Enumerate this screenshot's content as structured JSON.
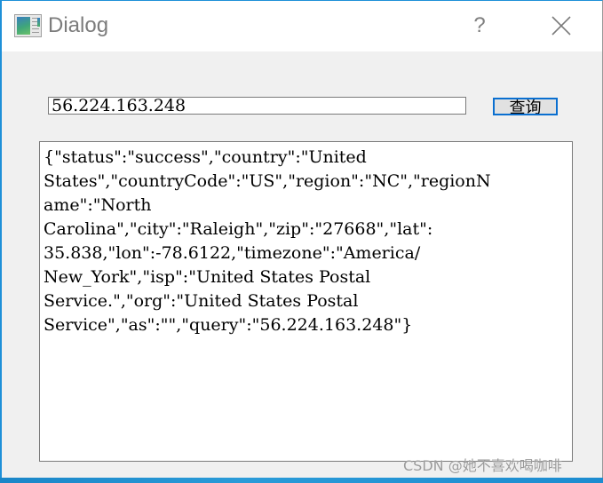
{
  "window": {
    "title": "Dialog",
    "help_symbol": "?",
    "close_label": "Close"
  },
  "query": {
    "ip_value": "56.224.163.248",
    "button_label": "查询"
  },
  "result": {
    "lines": [
      "{\"status\":\"success\",\"country\":\"United",
      "States\",\"countryCode\":\"US\",\"region\":\"NC\",\"regionN",
      "ame\":\"North",
      "Carolina\",\"city\":\"Raleigh\",\"zip\":\"27668\",\"lat\":",
      "35.838,\"lon\":-78.6122,\"timezone\":\"America/",
      "New_York\",\"isp\":\"United States Postal",
      "Service.\",\"org\":\"United States Postal",
      "Service\",\"as\":\"\",\"query\":\"56.224.163.248\"}"
    ]
  },
  "watermark": "CSDN @她不喜欢喝咖啡",
  "colors": {
    "accent_border": "#1e90d8",
    "button_focus": "#0a6fd0",
    "background": "#f0f0f0"
  }
}
